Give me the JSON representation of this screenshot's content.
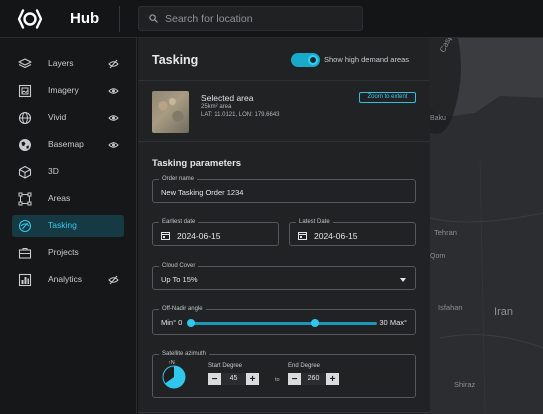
{
  "app": {
    "name": "Hub"
  },
  "search": {
    "placeholder": "Search for location"
  },
  "sidebar": {
    "items": [
      {
        "label": "Layers",
        "icon": "layers-icon",
        "visibility": "hidden"
      },
      {
        "label": "Imagery",
        "icon": "imagery-icon",
        "visibility": "visible"
      },
      {
        "label": "Vivid",
        "icon": "globe-icon",
        "visibility": "visible"
      },
      {
        "label": "Basemap",
        "icon": "basemap-icon",
        "visibility": "visible"
      },
      {
        "label": "3D",
        "icon": "cube-icon",
        "visibility": "none"
      },
      {
        "label": "Areas",
        "icon": "area-select-icon",
        "visibility": "none"
      },
      {
        "label": "Tasking",
        "icon": "tasking-icon",
        "visibility": "none",
        "active": true
      },
      {
        "label": "Projects",
        "icon": "briefcase-icon",
        "visibility": "none"
      },
      {
        "label": "Analytics",
        "icon": "analytics-icon",
        "visibility": "hidden"
      }
    ]
  },
  "panel": {
    "title": "Tasking",
    "demand_toggle": {
      "label": "Show high demand areas",
      "on": true
    },
    "selected_area": {
      "title": "Selected area",
      "size": "25km² area",
      "coords": "LAT: 11.0121, LON: 179.6643",
      "zoom_button": "Zoom to extent"
    },
    "params_title": "Tasking parameters",
    "order_name": {
      "label": "Order name",
      "value": "New Tasking Order 1234"
    },
    "earliest_date": {
      "label": "Earliest date",
      "value": "2024-06-15"
    },
    "latest_date": {
      "label": "Latest Date",
      "value": "2024-06-15"
    },
    "cloud_cover": {
      "label": "Cloud Cover",
      "value": "Up To 15%"
    },
    "off_nadir": {
      "label": "Off-Nadir angle",
      "min_label": "Min° 0",
      "max_label": "30 Max°",
      "min": 0,
      "max": 30,
      "low": 0,
      "high": 20
    },
    "azimuth": {
      "label": "Satellite azimuth",
      "north": "↑N",
      "start_label": "Start Degree",
      "start_value": "45",
      "to_label": "to",
      "end_label": "End Degree",
      "end_value": "260"
    }
  },
  "map": {
    "labels": [
      "Caspian Sea",
      "Baku",
      "Tehran",
      "Qom",
      "Isfahan",
      "Iran",
      "Shiraz"
    ]
  },
  "colors": {
    "accent": "#2fc8ec",
    "active_bg": "#163a44",
    "panel_bg": "#202224"
  }
}
